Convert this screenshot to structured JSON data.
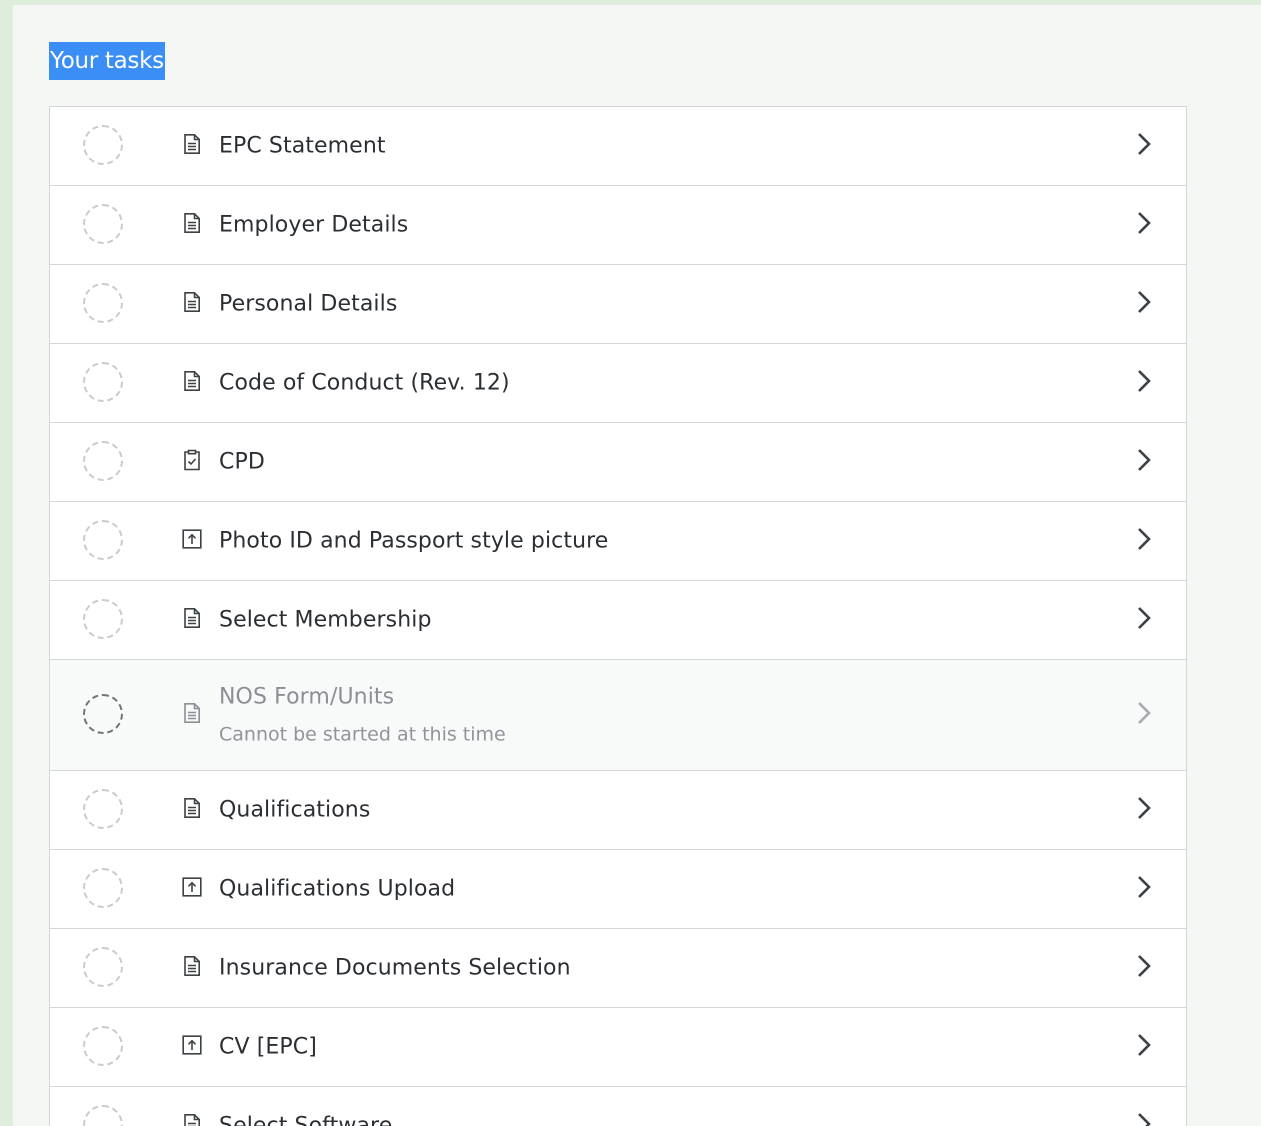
{
  "section": {
    "title": "Your tasks"
  },
  "tasks": [
    {
      "label": "EPC Statement",
      "icon": "document-icon",
      "disabled": false,
      "sublabel": ""
    },
    {
      "label": "Employer Details",
      "icon": "document-icon",
      "disabled": false,
      "sublabel": ""
    },
    {
      "label": "Personal Details",
      "icon": "document-icon",
      "disabled": false,
      "sublabel": ""
    },
    {
      "label": "Code of Conduct (Rev. 12)",
      "icon": "document-icon",
      "disabled": false,
      "sublabel": ""
    },
    {
      "label": "CPD",
      "icon": "clipboard-check-icon",
      "disabled": false,
      "sublabel": ""
    },
    {
      "label": "Photo ID and Passport style picture",
      "icon": "upload-icon",
      "disabled": false,
      "sublabel": ""
    },
    {
      "label": "Select Membership",
      "icon": "document-icon",
      "disabled": false,
      "sublabel": ""
    },
    {
      "label": "NOS Form/Units",
      "icon": "document-icon",
      "disabled": true,
      "sublabel": "Cannot be started at this time"
    },
    {
      "label": "Qualifications",
      "icon": "document-icon",
      "disabled": false,
      "sublabel": ""
    },
    {
      "label": "Qualifications Upload",
      "icon": "upload-icon",
      "disabled": false,
      "sublabel": ""
    },
    {
      "label": "Insurance Documents Selection",
      "icon": "document-icon",
      "disabled": false,
      "sublabel": ""
    },
    {
      "label": "CV [EPC]",
      "icon": "upload-icon",
      "disabled": false,
      "sublabel": ""
    },
    {
      "label": "Select Software",
      "icon": "document-icon",
      "disabled": false,
      "sublabel": ""
    }
  ],
  "colors": {
    "page_background": "#dfeedc",
    "panel_background": "#f5f7f5",
    "title_highlight": "#3b8ef5",
    "border": "#d4d7d9",
    "text": "#2b2f33",
    "muted_text": "#8f959a"
  }
}
